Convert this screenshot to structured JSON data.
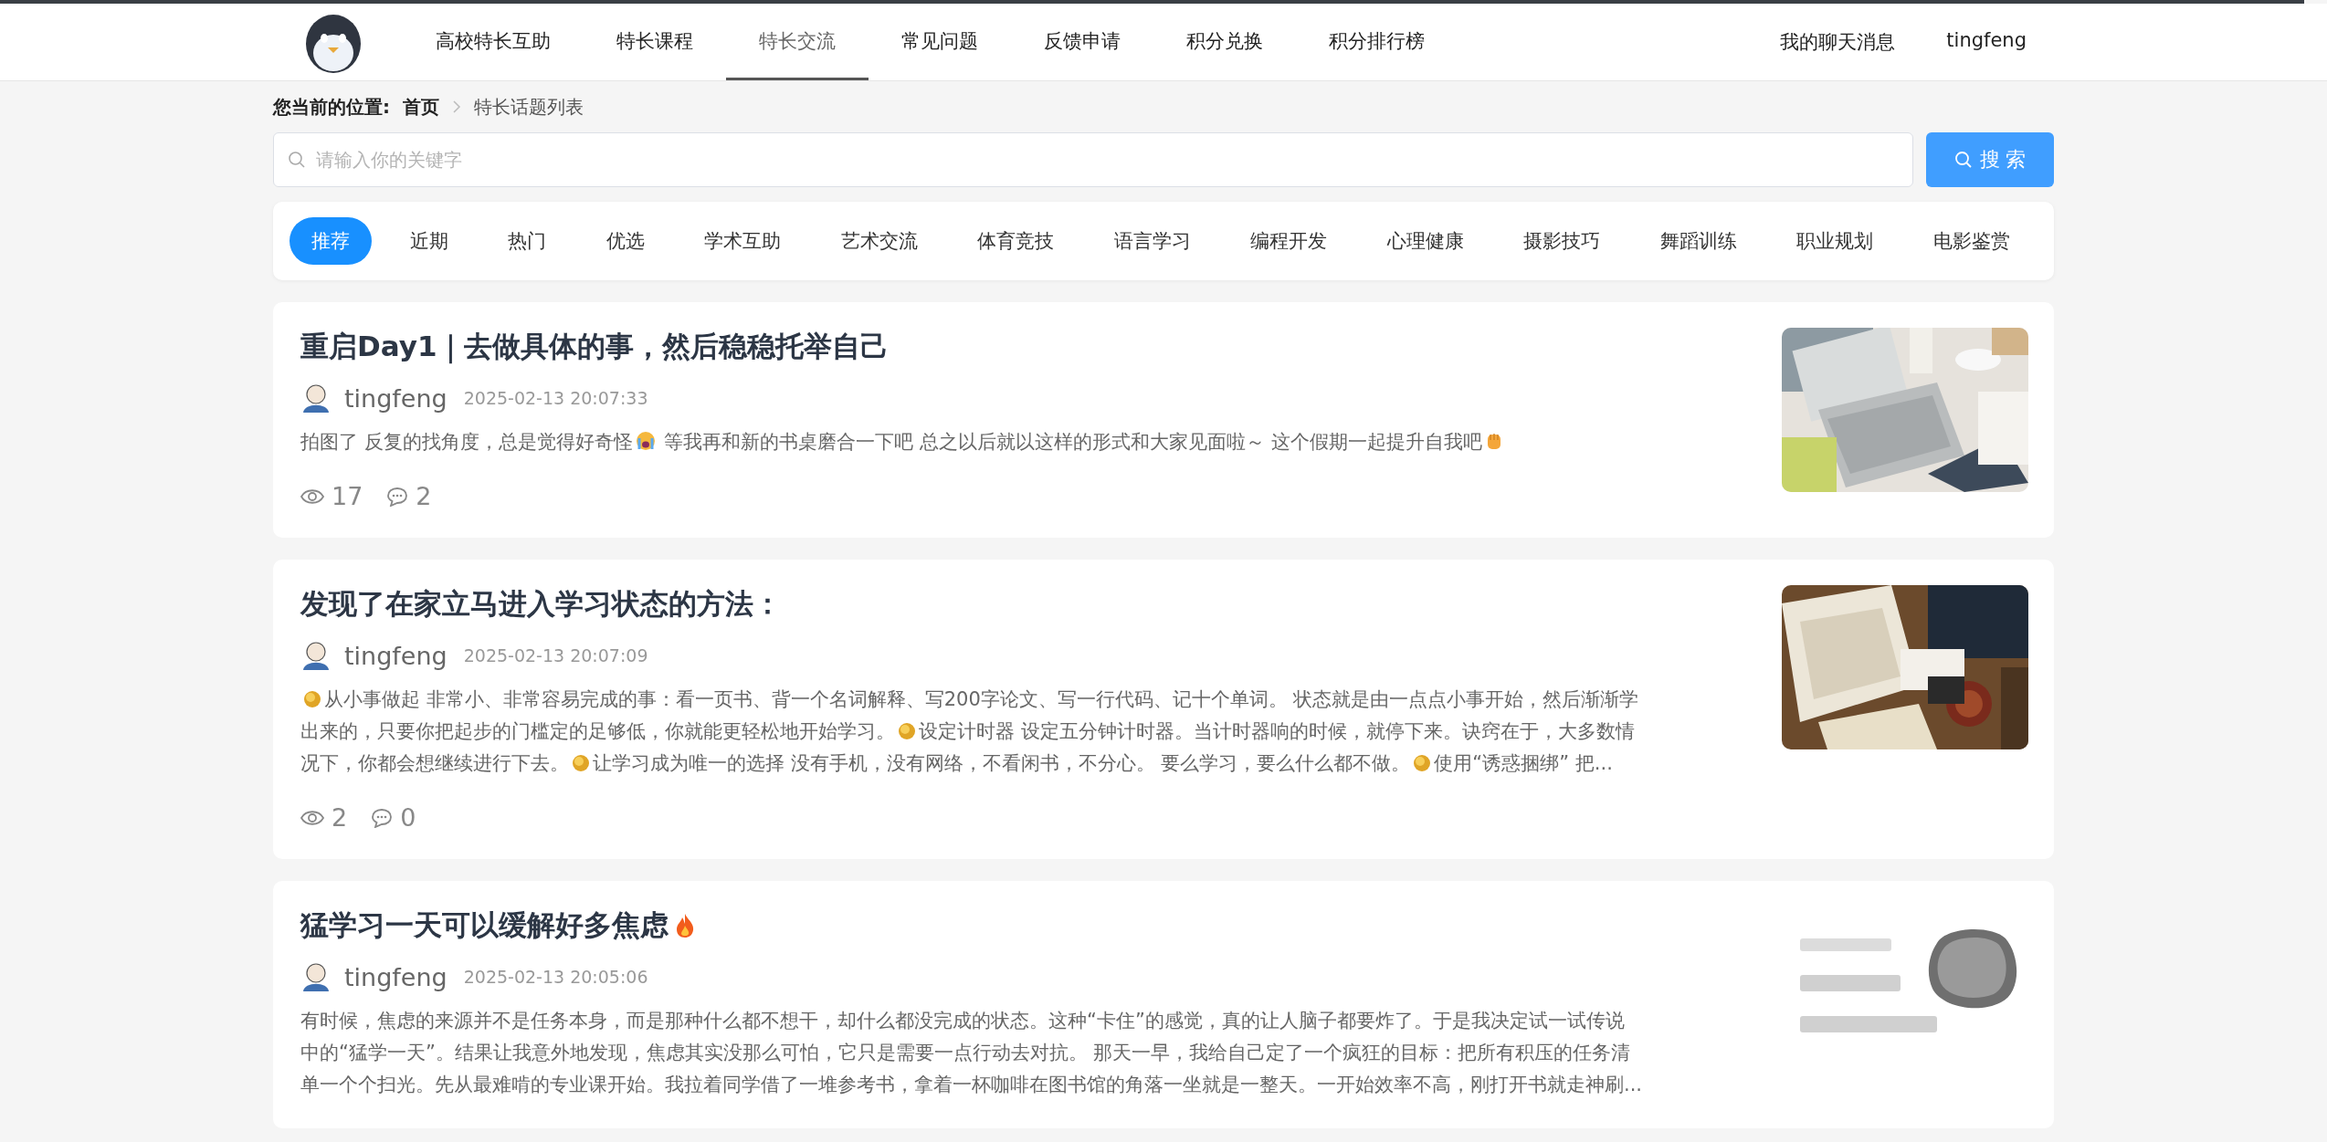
{
  "nav": {
    "items": [
      {
        "label": "高校特长互助",
        "selected": false
      },
      {
        "label": "特长课程",
        "selected": false
      },
      {
        "label": "特长交流",
        "selected": true
      },
      {
        "label": "常见问题",
        "selected": false
      },
      {
        "label": "反馈申请",
        "selected": false
      },
      {
        "label": "积分兑换",
        "selected": false
      },
      {
        "label": "积分排行榜",
        "selected": false
      }
    ],
    "right": [
      "我的聊天消息",
      "tingfeng"
    ]
  },
  "breadcrumb": {
    "label": "您当前的位置:",
    "items": [
      "首页",
      "特长话题列表"
    ]
  },
  "search": {
    "placeholder": "请输入你的关键字",
    "button": "搜 索"
  },
  "categories": [
    {
      "label": "推荐",
      "selected": true
    },
    {
      "label": "近期",
      "selected": false
    },
    {
      "label": "热门",
      "selected": false
    },
    {
      "label": "优选",
      "selected": false
    },
    {
      "label": "学术互助",
      "selected": false
    },
    {
      "label": "艺术交流",
      "selected": false
    },
    {
      "label": "体育竞技",
      "selected": false
    },
    {
      "label": "语言学习",
      "selected": false
    },
    {
      "label": "编程开发",
      "selected": false
    },
    {
      "label": "心理健康",
      "selected": false
    },
    {
      "label": "摄影技巧",
      "selected": false
    },
    {
      "label": "舞蹈训练",
      "selected": false
    },
    {
      "label": "职业规划",
      "selected": false
    },
    {
      "label": "电影鉴赏",
      "selected": false
    }
  ],
  "posts": [
    {
      "title": [
        {
          "kind": "text",
          "text": "重启Day1｜去做具体的事，然后稳稳托举自己"
        }
      ],
      "author": "tingfeng",
      "time": "2025-02-13 20:07:33",
      "excerpt": [
        [
          {
            "kind": "text",
            "text": "拍图了 反复的找角度，总是觉得好奇怪"
          },
          {
            "kind": "crying"
          },
          {
            "kind": "text",
            "text": " 等我再和新的书桌磨合一下吧 总之以后就以这样的形式和大家见面啦～ 这个假期一起提升自我吧"
          },
          {
            "kind": "fist"
          }
        ]
      ],
      "views": "17",
      "comments": "2"
    },
    {
      "title": [
        {
          "kind": "text",
          "text": "发现了在家立马进入学习状态的方法："
        }
      ],
      "author": "tingfeng",
      "time": "2025-02-13 20:07:09",
      "excerpt": [
        [
          {
            "kind": "coin"
          },
          {
            "kind": "text",
            "text": "从小事做起 非常小、非常容易完成的事：看一页书、背一个名词解释、写200字论文、写一行代码、记十个单词。 状态就是由一点点小事开始，然后渐渐学"
          }
        ],
        [
          {
            "kind": "text",
            "text": "出来的，只要你把起步的门槛定的足够低，你就能更轻松地开始学习。"
          },
          {
            "kind": "coin"
          },
          {
            "kind": "text",
            "text": "设定计时器 设定五分钟计时器。当计时器响的时候，就停下来。诀窍在于，大多数情"
          }
        ],
        [
          {
            "kind": "text",
            "text": "况下，你都会想继续进行下去。"
          },
          {
            "kind": "coin"
          },
          {
            "kind": "text",
            "text": "让学习成为唯一的选择 没有手机，没有网络，不看闲书，不分心。 要么学习，要么什么都不做。"
          },
          {
            "kind": "coin"
          },
          {
            "kind": "text",
            "text": "使用“诱惑捆绑” 把..."
          }
        ]
      ],
      "views": "2",
      "comments": "0"
    },
    {
      "title": [
        {
          "kind": "text",
          "text": "猛学习一天可以缓解好多焦虑"
        },
        {
          "kind": "fire"
        }
      ],
      "author": "tingfeng",
      "time": "2025-02-13 20:05:06",
      "excerpt": [
        [
          {
            "kind": "text",
            "text": "有时候，焦虑的来源并不是任务本身，而是那种什么都不想干，却什么都没完成的状态。这种“卡住”的感觉，真的让人脑子都要炸了。于是我决定试一试传说"
          }
        ],
        [
          {
            "kind": "text",
            "text": "中的“猛学一天”。结果让我意外地发现，焦虑其实没那么可怕，它只是需要一点行动去对抗。 那天一早，我给自己定了一个疯狂的目标：把所有积压的任务清"
          }
        ],
        [
          {
            "kind": "text",
            "text": "单一个个扫光。先从最难啃的专业课开始。我拉着同学借了一堆参考书，拿着一杯咖啡在图书馆的角落一坐就是一整天。一开始效率不高，刚打开书就走神刷..."
          }
        ]
      ]
    }
  ]
}
